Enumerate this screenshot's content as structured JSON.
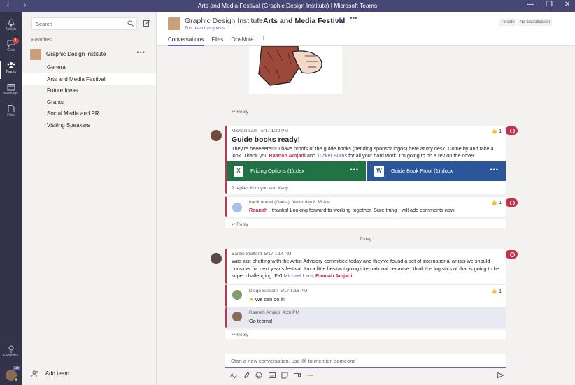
{
  "window": {
    "title": "Arts and Media Festival (Graphic Design Institute) | Microsoft Teams",
    "nav_back": "‹",
    "nav_forward": "›",
    "minimize": "—",
    "restore": "❐",
    "close": "✕"
  },
  "rail": {
    "items": [
      {
        "label": "Activity"
      },
      {
        "label": "Chat",
        "badge": "1"
      },
      {
        "label": "Teams"
      },
      {
        "label": "Meetings"
      },
      {
        "label": "Files"
      }
    ],
    "feedback": "Feedback",
    "user_status": "1st"
  },
  "sidebar": {
    "search_placeholder": "Search",
    "favorites_label": "Favorites",
    "team_name": "Graphic Design Institute",
    "team_more": "•••",
    "channels": [
      "General",
      "Arts and Media Festival",
      "Future Ideas",
      "Grants",
      "Social Media and PR",
      "Visiting Speakers"
    ],
    "active_channel_index": 1,
    "add_team": "Add team"
  },
  "header": {
    "team": "Graphic Design Institute",
    "separator": ">",
    "channel": "Arts and Media Festival",
    "star": "★",
    "more": "•••",
    "guests_note": "This team has guests",
    "private": "Private",
    "classification": "No classification",
    "tabs": [
      "Conversations",
      "Files",
      "OneNote"
    ],
    "add_tab": "+"
  },
  "conversation": {
    "reply_label": "Reply",
    "thread1": {
      "author": "Michael Lam",
      "time": "5/17 1:22 PM",
      "title": "Guide books ready!",
      "body_1": "They're heeeeere!!!!  I have proofs of the guide books (pending sponsor logos) here at my desk. Come by and take a look. Thank you ",
      "mention_1": "Raanah Amjadi",
      "body_2": " and ",
      "mention_2": "Tucker Burns",
      "body_3": " for all your hard work.  I'm going to do a rev on the cover.",
      "likes": "1",
      "files": [
        {
          "name": "Pricing Options (1).xlsx",
          "icon": "X",
          "color": "#217346"
        },
        {
          "name": "Guide Book Proof (1).docx",
          "icon": "W",
          "color": "#2b579a"
        }
      ],
      "file_more": "•••",
      "replies_summary": "2 replies from you and Kady",
      "reply": {
        "author": "hardiruuutel (Guest)",
        "time": "Yesterday 8:36 AM",
        "mention": "Raanah",
        "body": " - thanks! Looking forward to working together. Sure thing - will add comments now.",
        "likes": "1"
      }
    },
    "divider": "Today",
    "thread2": {
      "author": "Barbie Stafford",
      "time": "5/17 1:14 PM",
      "body_1": "Was just chatting with the Artist Advisory committee today and they've found a set of international artists we should consider for next year's festival. I'm a little hesitant going international because I think the logistics of that is going to be super challenging. FYI ",
      "mention_1": "Michael Lam",
      "body_2": ", ",
      "mention_2": "Raanah Amjadi",
      "reply1": {
        "author": "Diego Siciliani",
        "time": "5/17 1:16 PM",
        "body": "We can do it!",
        "likes": "1"
      },
      "reply2": {
        "author": "Raanah Amjadi",
        "time": "4:26 PM",
        "body": "Go teams!"
      }
    },
    "compose_placeholder": "Start a new conversation, use @ to mention someone"
  }
}
